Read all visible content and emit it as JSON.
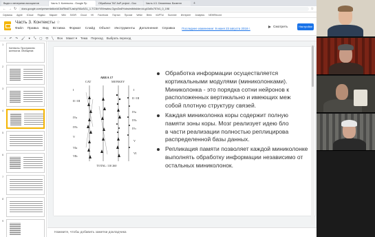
{
  "browser": {
    "tabs": [
      {
        "label": "Видео с вечеринки ассоциатов"
      },
      {
        "label": "Часть 3. Контексты - Google Пр"
      },
      {
        "label": "Обработка ТАГ АоР project - Goo"
      },
      {
        "label": "Часть 4.3. Семантика. Валентн"
      }
    ],
    "new_tab": "+",
    "url": "docs.google.com/presentation/d/1toRbs67LashpYAlzAGL_1-TC3kYVMmwkw-OgnrZw8Yvdw/edit#slide=id.g43d0c757d1_0_198",
    "bookmarks": [
      "Сервисы",
      "Apple",
      "iCloud",
      "Яндекс",
      "Маркет",
      "Wiki",
      "SIGIR",
      "Cloud",
      "VK",
      "Facebook",
      "Портал",
      "Прочие",
      "Wrike",
      "Bitrix",
      "КАРТЫ",
      "Summer",
      "Интернет",
      "Analytics",
      "NEWRecord"
    ]
  },
  "app": {
    "title": "Часть 3. Контексты",
    "star": "☆",
    "menus": [
      "Файл",
      "Правка",
      "Вид",
      "Вставка",
      "Формат",
      "Слайд",
      "Объект",
      "Инструменты",
      "Дополнения",
      "Справка"
    ],
    "last_edit": "Последнее изменение: 9 июня 23 августа 2018 г.",
    "present_label": "Смотреть",
    "settings_label": "Настройки доступа"
  },
  "toolbar": {
    "items": [
      "+",
      "↶",
      "↷",
      "🖌",
      "▾",
      "⤡",
      "▢",
      "⬭",
      "╲",
      "Фон",
      "Макет ▾",
      "Тема",
      "Переход",
      "Выбрать переход"
    ]
  },
  "filmstrip": {
    "slides": [
      {
        "num": "1",
        "text": "Контексты. Пространство контекстов. Обобщение.",
        "kind": "title"
      },
      {
        "num": "2",
        "text": "",
        "kind": "figure"
      },
      {
        "num": "3",
        "text": "",
        "kind": "figure"
      },
      {
        "num": "4",
        "text": "",
        "kind": "figure",
        "selected": true
      },
      {
        "num": "5",
        "text": "",
        "kind": "text"
      },
      {
        "num": "6",
        "text": "",
        "kind": "figure"
      },
      {
        "num": "7",
        "text": "",
        "kind": "text"
      },
      {
        "num": "8",
        "text": "",
        "kind": "text"
      },
      {
        "num": "9",
        "text": "",
        "kind": "figure"
      }
    ]
  },
  "slide": {
    "figure": {
      "area_title": "AREA 17",
      "col_left": "CAT",
      "col_right": "MONKEY",
      "layers_left": [
        "I",
        "II / III",
        "IVa",
        "IVb",
        "V",
        "VIa",
        "VIb"
      ],
      "layers_right": [
        "I",
        "II / III",
        "IVa",
        "IVb",
        "IVc",
        "V",
        "VI"
      ],
      "total": "TOTAL:  110          260"
    },
    "bullets": [
      {
        "lines": [
          "Обработка информации осуществляется",
          "кортикальными модулями (миниколонками).",
          "Миниколонка - это порядка сотни нейронов к",
          "расположенных вертикально и имеющих меж",
          "собой плотную структуру связей."
        ]
      },
      {
        "lines": [
          "Каждая миниколонка коры содержит полную",
          "памяти зоны коры. Мозг реализует идею бло",
          "в части реализации полностью реплицирова",
          "распределенной базы данных."
        ]
      },
      {
        "lines": [
          "Репликация памяти позволяет каждой миниколонке",
          "выполнять обработку информации независимо от",
          "остальных миниколонок."
        ]
      }
    ]
  },
  "notes": {
    "placeholder": "Нажмите, чтобы добавить заметки докладчика"
  },
  "video": {
    "participants": [
      {
        "name": "participant-1",
        "bg": "#d9d2c4",
        "skin": "#e3b89a",
        "shirt": "#2d3e55"
      },
      {
        "name": "participant-2",
        "bg": "#6b1f14",
        "skin": "#c79b86",
        "shirt": "#3a2a24"
      },
      {
        "name": "participant-3",
        "bg": "#3e3d38",
        "skin": "#b58d75",
        "shirt": "#4b4a45"
      },
      {
        "name": "participant-4",
        "bg": "#5a5a58",
        "skin": "#cfa58f",
        "shirt": "#2a2a2a"
      }
    ]
  },
  "colors": {
    "accent_blue": "#1a73e8",
    "slides_yellow": "#f4b400",
    "text": "#333333"
  }
}
